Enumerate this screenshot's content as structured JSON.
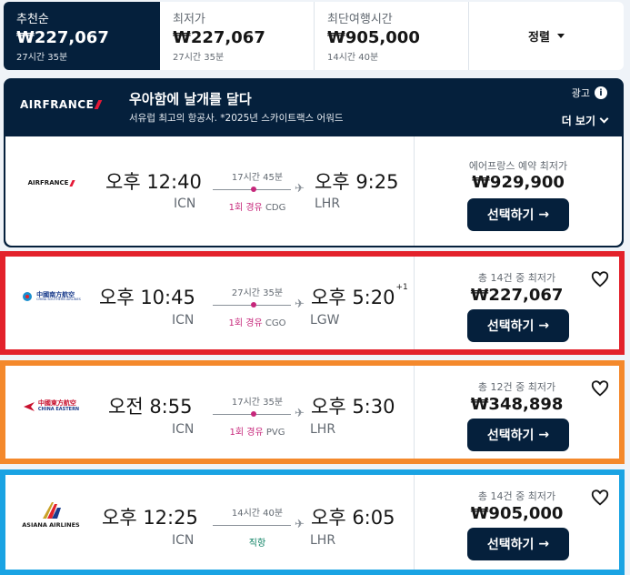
{
  "tabs": [
    {
      "label": "추천순",
      "price": "₩227,067",
      "duration": "27시간 35분"
    },
    {
      "label": "최저가",
      "price": "₩227,067",
      "duration": "27시간 35분"
    },
    {
      "label": "최단여행시간",
      "price": "₩905,000",
      "duration": "14시간 40분"
    }
  ],
  "sort": {
    "label": "정렬",
    "icon": "caret-down-icon"
  },
  "ad": {
    "airline_logo": "AIRFRANCE",
    "tagline": "우아함에 날개를 달다",
    "subline": "서유럽 최고의 항공사. *2025년 스카이트랙스 어워드",
    "ad_label": "광고",
    "more_label": "더 보기",
    "flight": {
      "airline_logo": "AIRFRANCE",
      "dep_time": "오후 12:40",
      "dep_airport": "ICN",
      "duration": "17시간 45분",
      "stops": "1회 경유",
      "via": "CDG",
      "arr_time": "오후 9:25",
      "arr_airport": "LHR",
      "price_label": "에어프랑스 예약 최저가",
      "price": "₩929,900",
      "button": "선택하기"
    }
  },
  "results": [
    {
      "airline_logo": "中國南方航空",
      "airline_logo_sub": "CHINA SOUTHERN AIRLINES",
      "dep_time": "오후 10:45",
      "dep_airport": "ICN",
      "duration": "27시간 35분",
      "stops": "1회 경유",
      "via": "CGO",
      "arr_time": "오후 5:20",
      "arr_day_offset": "+1",
      "arr_airport": "LGW",
      "price_label": "총 14건 중 최저가",
      "price": "₩227,067",
      "button": "선택하기",
      "frame_color": "#e3222b"
    },
    {
      "airline_logo": "中國東方航空",
      "airline_logo_sub": "CHINA EASTERN",
      "dep_time": "오전 8:55",
      "dep_airport": "ICN",
      "duration": "17시간 35분",
      "stops": "1회 경유",
      "via": "PVG",
      "arr_time": "오후 5:30",
      "arr_airport": "LHR",
      "price_label": "총 12건 중 최저가",
      "price": "₩348,898",
      "button": "선택하기",
      "frame_color": "#f4892c"
    },
    {
      "airline_logo": "ASIANA AIRLINES",
      "dep_time": "오후 12:25",
      "dep_airport": "ICN",
      "duration": "14시간 40분",
      "stops": "직항",
      "arr_time": "오후 6:05",
      "arr_airport": "LHR",
      "price_label": "총 14건 중 최저가",
      "price": "₩905,000",
      "button": "선택하기",
      "frame_color": "#1aa3e3"
    }
  ],
  "colors": {
    "navy": "#05203c",
    "stop_pink": "#c6277b",
    "direct_green": "#0b8062"
  }
}
